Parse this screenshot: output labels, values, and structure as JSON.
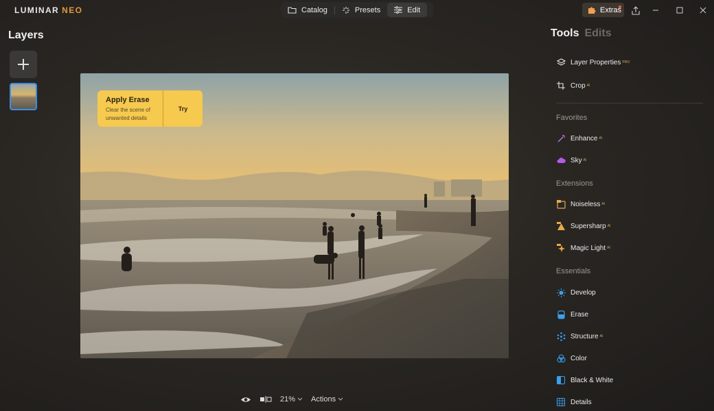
{
  "app": {
    "logo_main": "LUMINAR",
    "logo_accent": "NEO"
  },
  "nav": {
    "tabs": [
      {
        "label": "Catalog",
        "icon": "folder-icon"
      },
      {
        "label": "Presets",
        "icon": "sparkles-icon"
      },
      {
        "label": "Edit",
        "icon": "sliders-icon",
        "active": true
      }
    ]
  },
  "header_right": {
    "extras_label": "Extras"
  },
  "layers": {
    "title": "Layers"
  },
  "erase_card": {
    "title": "Apply Erase",
    "description": "Clear the scene of unwanted details",
    "action": "Try"
  },
  "bottom": {
    "zoom": "21%",
    "actions_label": "Actions"
  },
  "tools_panel": {
    "tab_tools": "Tools",
    "tab_edits": "Edits",
    "top_items": [
      {
        "label": "Layer Properties",
        "badge": "PRO"
      },
      {
        "label": "Crop",
        "badge": "AI"
      }
    ],
    "sections": [
      {
        "title": "Favorites",
        "items": [
          {
            "label": "Enhance",
            "badge": "AI"
          },
          {
            "label": "Sky",
            "badge": "AI"
          }
        ]
      },
      {
        "title": "Extensions",
        "items": [
          {
            "label": "Noiseless",
            "badge": "AI"
          },
          {
            "label": "Supersharp",
            "badge": "AI"
          },
          {
            "label": "Magic Light",
            "badge": "AI"
          }
        ]
      },
      {
        "title": "Essentials",
        "items": [
          {
            "label": "Develop",
            "badge": ""
          },
          {
            "label": "Erase",
            "badge": ""
          },
          {
            "label": "Structure",
            "badge": "AI"
          },
          {
            "label": "Color",
            "badge": ""
          },
          {
            "label": "Black & White",
            "badge": ""
          },
          {
            "label": "Details",
            "badge": ""
          }
        ]
      }
    ]
  },
  "colors": {
    "accent_blue": "#3d8ee8",
    "erase_yellow": "#f6c94f",
    "logo_orange": "#e39a3a"
  }
}
